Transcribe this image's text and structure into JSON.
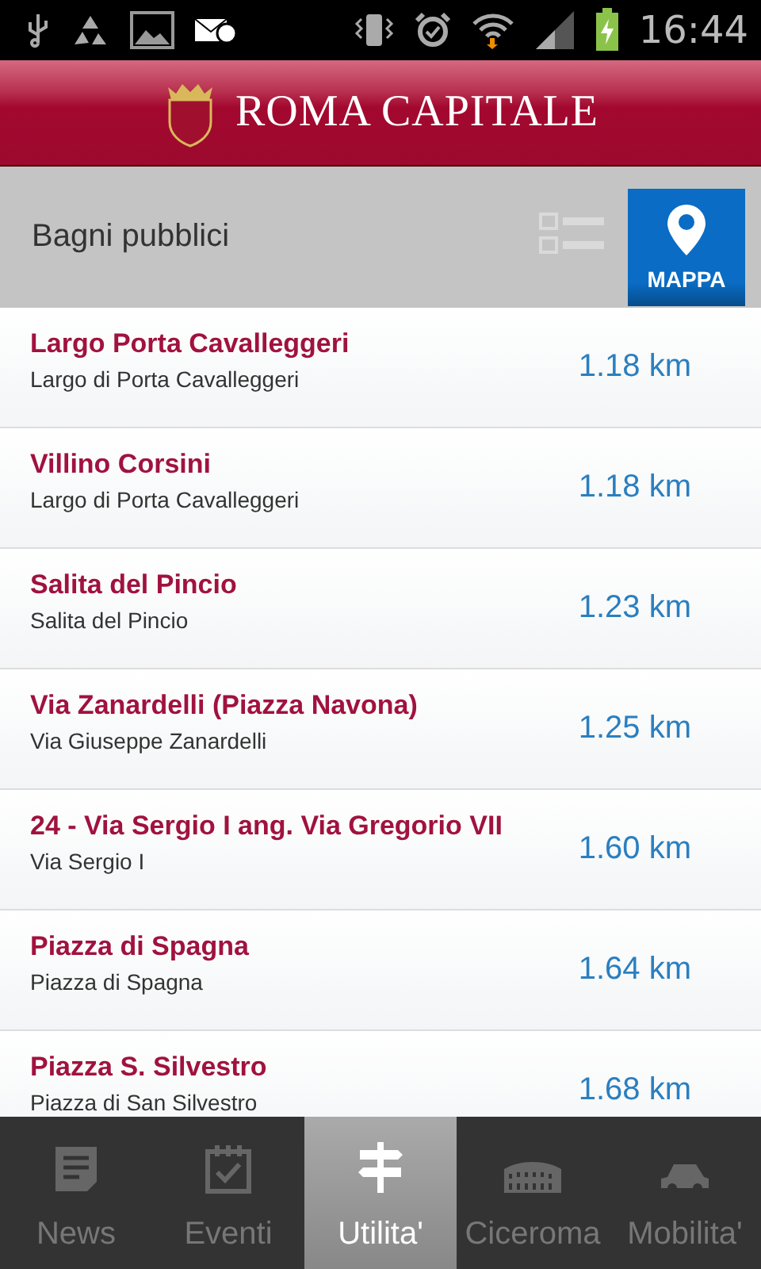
{
  "status_bar": {
    "time": "16:44"
  },
  "header": {
    "title": "ROMA CAPITALE"
  },
  "toolbar": {
    "title": "Bagni pubblici",
    "views": [
      {
        "kind": "list",
        "selected": false
      },
      {
        "kind": "map",
        "label": "MAPPA",
        "selected": true
      }
    ]
  },
  "items": [
    {
      "name": "Largo Porta Cavalleggeri",
      "address": "Largo di Porta Cavalleggeri",
      "distance": "1.18 km"
    },
    {
      "name": "Villino Corsini",
      "address": "Largo di Porta Cavalleggeri",
      "distance": "1.18 km"
    },
    {
      "name": "Salita del Pincio",
      "address": "Salita del Pincio",
      "distance": "1.23 km"
    },
    {
      "name": "Via Zanardelli (Piazza Navona)",
      "address": "Via Giuseppe Zanardelli",
      "distance": "1.25 km"
    },
    {
      "name": "24 - Via Sergio I ang. Via Gregorio VII",
      "address": "Via Sergio I",
      "distance": "1.60 km"
    },
    {
      "name": "Piazza di Spagna",
      "address": "Piazza di Spagna",
      "distance": "1.64 km"
    },
    {
      "name": "Piazza S. Silvestro",
      "address": "Piazza di San Silvestro",
      "distance": "1.68 km"
    }
  ],
  "tabs": [
    {
      "label": "News",
      "selected": false
    },
    {
      "label": "Eventi",
      "selected": false
    },
    {
      "label": "Utilita'",
      "selected": true
    },
    {
      "label": "Ciceroma",
      "selected": false
    },
    {
      "label": "Mobilita'",
      "selected": false
    }
  ]
}
